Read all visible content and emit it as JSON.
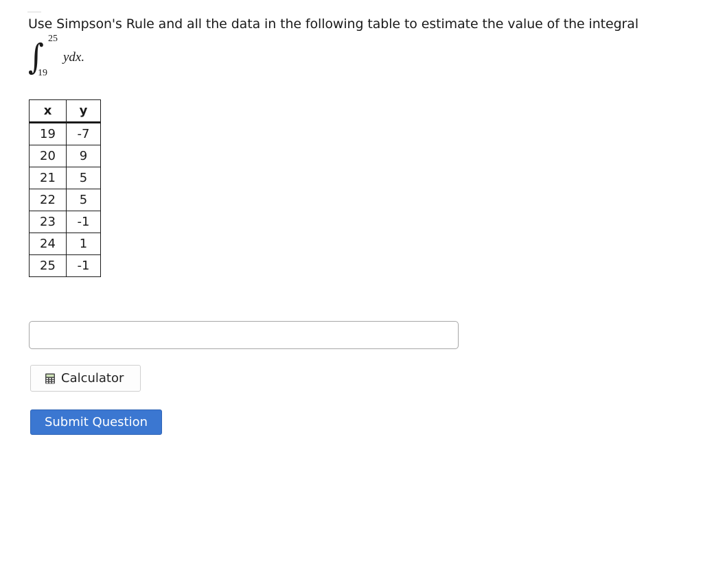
{
  "question": {
    "prompt": "Use Simpson's Rule and all the data in the following table to estimate the value of the integral",
    "integral": {
      "sign": "∫",
      "upper_limit": "25",
      "lower_limit": "19",
      "integrand": "ydx."
    }
  },
  "table": {
    "headers": [
      "x",
      "y"
    ],
    "rows": [
      [
        "19",
        "-7"
      ],
      [
        "20",
        "9"
      ],
      [
        "21",
        "5"
      ],
      [
        "22",
        "5"
      ],
      [
        "23",
        "-1"
      ],
      [
        "24",
        "1"
      ],
      [
        "25",
        "-1"
      ]
    ]
  },
  "answer": {
    "value": "",
    "placeholder": ""
  },
  "buttons": {
    "calculator_label": "Calculator",
    "calculator_icon": "calculator-icon",
    "submit_label": "Submit Question"
  },
  "colors": {
    "submit_background": "#3b77d1",
    "submit_text": "#ffffff"
  }
}
